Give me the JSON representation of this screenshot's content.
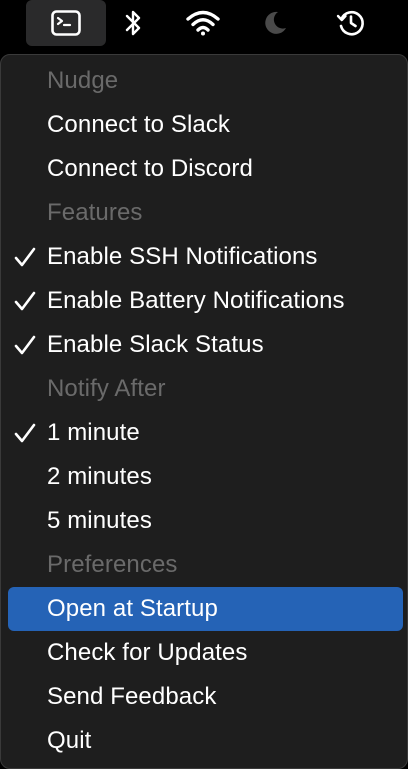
{
  "menubar": {
    "icons": [
      {
        "name": "terminal-icon",
        "active": true
      },
      {
        "name": "bluetooth-icon",
        "active": false
      },
      {
        "name": "wifi-icon",
        "active": false
      },
      {
        "name": "moon-icon",
        "active": false
      },
      {
        "name": "time-machine-icon",
        "active": false
      }
    ]
  },
  "menu": {
    "items": [
      {
        "label": "Nudge",
        "type": "header",
        "checked": false
      },
      {
        "label": "Connect to Slack",
        "type": "item",
        "checked": false
      },
      {
        "label": "Connect to Discord",
        "type": "item",
        "checked": false
      },
      {
        "label": "Features",
        "type": "header",
        "checked": false
      },
      {
        "label": "Enable SSH Notifications",
        "type": "item",
        "checked": true
      },
      {
        "label": "Enable Battery Notifications",
        "type": "item",
        "checked": true
      },
      {
        "label": "Enable Slack Status",
        "type": "item",
        "checked": true
      },
      {
        "label": "Notify After",
        "type": "header",
        "checked": false
      },
      {
        "label": "1 minute",
        "type": "item",
        "checked": true
      },
      {
        "label": "2 minutes",
        "type": "item",
        "checked": false
      },
      {
        "label": "5 minutes",
        "type": "item",
        "checked": false
      },
      {
        "label": "Preferences",
        "type": "header",
        "checked": false
      },
      {
        "label": "Open at Startup",
        "type": "item",
        "checked": false,
        "highlighted": true
      },
      {
        "label": "Check for Updates",
        "type": "item",
        "checked": false
      },
      {
        "label": "Send Feedback",
        "type": "item",
        "checked": false
      },
      {
        "label": "Quit",
        "type": "item",
        "checked": false
      }
    ]
  },
  "colors": {
    "highlight": "#2563b6",
    "menu_background": "#1e1e1e",
    "header_text": "#6a6a6a",
    "item_text": "#ffffff"
  }
}
